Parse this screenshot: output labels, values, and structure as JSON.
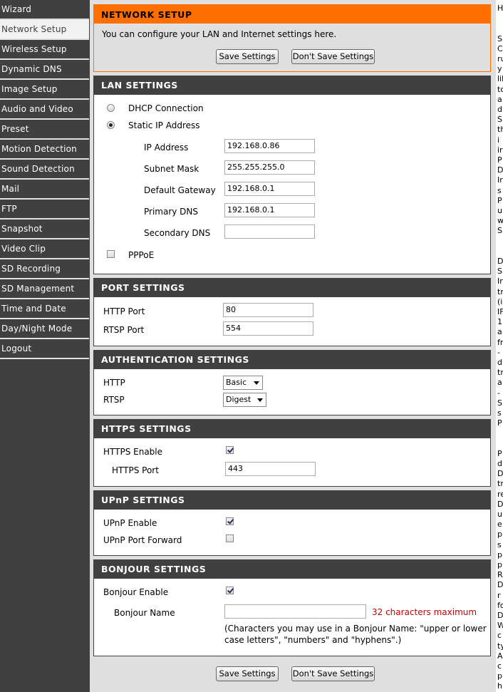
{
  "sidebar": {
    "items": [
      {
        "label": "Wizard"
      },
      {
        "label": "Network Setup"
      },
      {
        "label": "Wireless Setup"
      },
      {
        "label": "Dynamic DNS"
      },
      {
        "label": "Image Setup"
      },
      {
        "label": "Audio and Video"
      },
      {
        "label": "Preset"
      },
      {
        "label": "Motion Detection"
      },
      {
        "label": "Sound Detection"
      },
      {
        "label": "Mail"
      },
      {
        "label": "FTP"
      },
      {
        "label": "Snapshot"
      },
      {
        "label": "Video Clip"
      },
      {
        "label": "SD Recording"
      },
      {
        "label": "SD Management"
      },
      {
        "label": "Time and Date"
      },
      {
        "label": "Day/Night Mode"
      },
      {
        "label": "Logout"
      }
    ],
    "active_index": 1
  },
  "network_setup": {
    "title": "NETWORK SETUP",
    "description": "You can configure your LAN and Internet settings here.",
    "save_label": "Save Settings",
    "dont_save_label": "Don't Save Settings"
  },
  "lan": {
    "title": "LAN SETTINGS",
    "dhcp_label": "DHCP Connection",
    "static_label": "Static IP Address",
    "ip_label": "IP Address",
    "ip_value": "192.168.0.86",
    "subnet_label": "Subnet Mask",
    "subnet_value": "255.255.255.0",
    "gateway_label": "Default Gateway",
    "gateway_value": "192.168.0.1",
    "pdns_label": "Primary DNS",
    "pdns_value": "192.168.0.1",
    "sdns_label": "Secondary DNS",
    "sdns_value": "",
    "pppoe_label": "PPPoE"
  },
  "port": {
    "title": "PORT SETTINGS",
    "http_label": "HTTP Port",
    "http_value": "80",
    "rtsp_label": "RTSP Port",
    "rtsp_value": "554"
  },
  "auth": {
    "title": "AUTHENTICATION SETTINGS",
    "http_label": "HTTP",
    "http_value": "Basic",
    "rtsp_label": "RTSP",
    "rtsp_value": "Digest"
  },
  "https": {
    "title": "HTTPS SETTINGS",
    "enable_label": "HTTPS Enable",
    "port_label": "HTTPS Port",
    "port_value": "443"
  },
  "upnp": {
    "title": "UPnP SETTINGS",
    "enable_label": "UPnP Enable",
    "forward_label": "UPnP Port Forward"
  },
  "bonjour": {
    "title": "BONJOUR SETTINGS",
    "enable_label": "Bonjour Enable",
    "name_label": "Bonjour Name",
    "name_value": "",
    "max_note": "32 characters maximum",
    "hint_line1": "(Characters you may use in a Bonjour Name: \"upper or lower",
    "hint_line2": "case letters\", \"numbers\" and \"hyphens\".)"
  },
  "footer": {
    "save_label": "Save Settings",
    "dont_save_label": "Don't Save Settings"
  },
  "help_panel": {
    "letters": [
      "H",
      "",
      "",
      "S",
      "C",
      "ru",
      "y",
      "lik",
      "to",
      "a",
      "d",
      "S",
      "th",
      "i",
      "ir",
      "P",
      "D",
      "Ir",
      "s",
      "P",
      "u",
      "w",
      "S",
      "",
      "",
      "D",
      "S",
      "Ir",
      "tr",
      "(i",
      "IF",
      "1",
      "a",
      "fr",
      "-",
      "d",
      "tr",
      "a",
      "-",
      "S",
      "s",
      "P",
      "",
      "",
      "P",
      "d",
      "D",
      "tr",
      "re",
      "D",
      "u",
      "e",
      "p",
      "s",
      "p",
      "p",
      "R",
      "D",
      "r",
      "fo",
      "D",
      "W",
      "c",
      "ty",
      "A",
      "c",
      "p",
      "h"
    ]
  },
  "colors": {
    "sidebar_bg": "#404040",
    "header_orange": "#ff6f00",
    "section_header": "#404040",
    "warning_red": "#cc0000",
    "page_bg": "#dfdfdf"
  }
}
